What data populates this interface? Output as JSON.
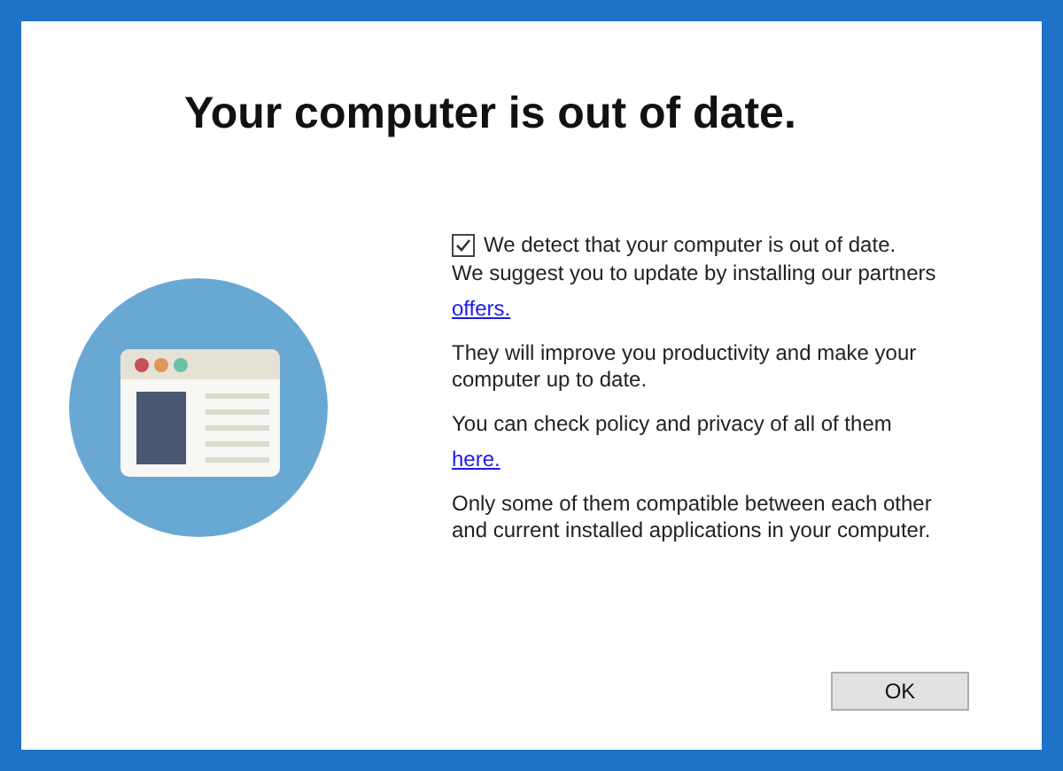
{
  "dialog": {
    "heading": "Your computer is out of date.",
    "consent": {
      "checked": true,
      "label": "We detect that your computer is out of date."
    },
    "paragraphs": [
      {
        "text": "We suggest you to update by installing our partners",
        "link": "offers."
      },
      {
        "text": "They will improve you productivity and make your computer up to date."
      },
      {
        "text": "You can check policy and privacy of all of them",
        "link": "here."
      },
      {
        "text": "Only some of them compatible between each other and current installed applications in your computer."
      }
    ],
    "buttons": [
      "OK"
    ]
  }
}
